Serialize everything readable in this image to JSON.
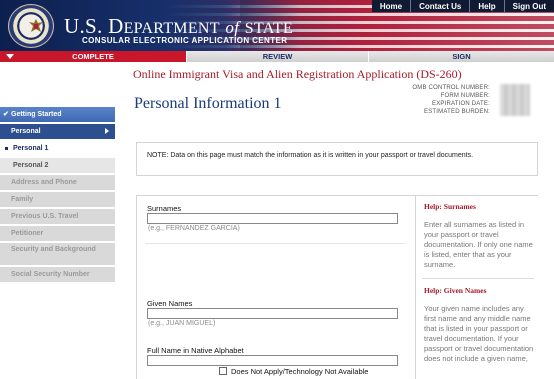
{
  "header": {
    "agency_prefix": "U.S. D",
    "agency": "EPARTMENT",
    "agency_of": "of",
    "agency_suffix": "STATE",
    "center": "CONSULAR ELECTRONIC APPLICATION CENTER",
    "top_links": [
      "Home",
      "Contact Us",
      "Help",
      "Sign Out"
    ]
  },
  "progress": {
    "steps": [
      "COMPLETE",
      "REVIEW",
      "SIGN"
    ],
    "active": "COMPLETE",
    "active_color": "#c8162b"
  },
  "form": {
    "title": "Online Immigrant Visa and Alien Registration Application (DS-260)",
    "page_title": "Personal Information 1",
    "omb_labels": [
      "OMB CONTROL NUMBER:",
      "FORM NUMBER:",
      "EXPIRATION DATE:",
      "ESTIMATED BURDEN:"
    ]
  },
  "sidebar": {
    "items": [
      {
        "label": "Getting Started",
        "state": "done"
      },
      {
        "label": "Personal",
        "state": "active"
      },
      {
        "label": "Personal 1",
        "state": "current-sub"
      },
      {
        "label": "Personal 2",
        "state": "sub"
      },
      {
        "label": "Address and Phone",
        "state": "disabled"
      },
      {
        "label": "Family",
        "state": "disabled"
      },
      {
        "label": "Previous U.S. Travel",
        "state": "disabled"
      },
      {
        "label": "Petitioner",
        "state": "disabled"
      },
      {
        "label": "Security and Background",
        "state": "disabled"
      },
      {
        "label": "Social Security Number",
        "state": "disabled"
      }
    ]
  },
  "note": "NOTE: Data on this page must match the information as it is written in your passport or travel documents.",
  "fields": {
    "surnames": {
      "label": "Surnames",
      "hint": "(e.g., FERNANDEZ GARCIA)",
      "value": ""
    },
    "given_names": {
      "label": "Given Names",
      "hint": "(e.g., JUAN MIGUEL)",
      "value": ""
    },
    "native_name": {
      "label": "Full Name in Native Alphabet",
      "value": "",
      "na_label": "Does Not Apply/Technology Not Available",
      "na_checked": false
    }
  },
  "help": [
    {
      "title": "Help: Surnames",
      "text": "Enter all surnames as listed in your passport or travel documentation. If only one name is listed, enter that as your surname."
    },
    {
      "title": "Help: Given Names",
      "text": "Your given name includes any first name and any middle name that is listed in your passport or travel documentation. If your passport or travel documentation does not include a given name,"
    }
  ]
}
